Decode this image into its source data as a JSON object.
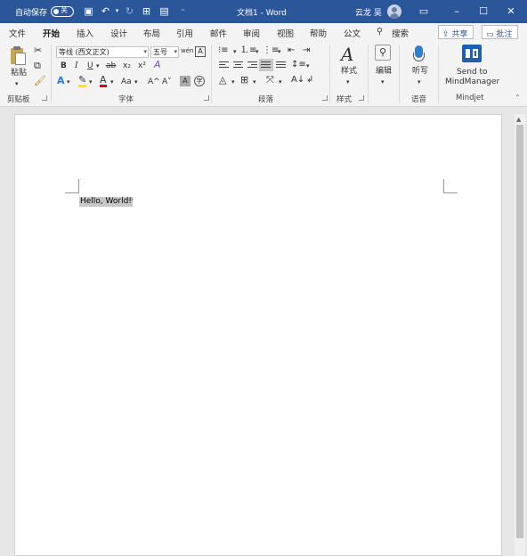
{
  "titlebar": {
    "autosave_label": "自动保存",
    "autosave_state": "关",
    "doc_title": "文档1 - Word",
    "user_name": "云龙 吴",
    "bg_color": "#2b579a"
  },
  "tabs": {
    "items": [
      "文件",
      "开始",
      "插入",
      "设计",
      "布局",
      "引用",
      "邮件",
      "审阅",
      "视图",
      "帮助",
      "公文"
    ],
    "active": "开始",
    "search_label": "搜索",
    "share_label": "共享",
    "comments_label": "批注"
  },
  "ribbon": {
    "clipboard": {
      "paste_label": "粘贴",
      "group_label": "剪贴板"
    },
    "font": {
      "font_name": "等线 (西文正文)",
      "font_size": "五号",
      "bold": "B",
      "italic": "I",
      "underline": "U",
      "strike": "ab",
      "subscript": "x₂",
      "superscript": "x²",
      "grow": "A^",
      "shrink": "A˅",
      "change_case": "Aa",
      "group_label": "字体"
    },
    "paragraph": {
      "group_label": "段落"
    },
    "styles": {
      "styles_label": "样式",
      "group_label": "样式"
    },
    "editing": {
      "edit_label": "编辑"
    },
    "voice": {
      "dictate_label": "听写",
      "group_label": "语音"
    },
    "mindjet": {
      "line1": "Send to",
      "line2": "MindManager",
      "group_label": "Mindjet"
    }
  },
  "document": {
    "text": "Hello, World!",
    "paragraph_mark": "↵"
  }
}
